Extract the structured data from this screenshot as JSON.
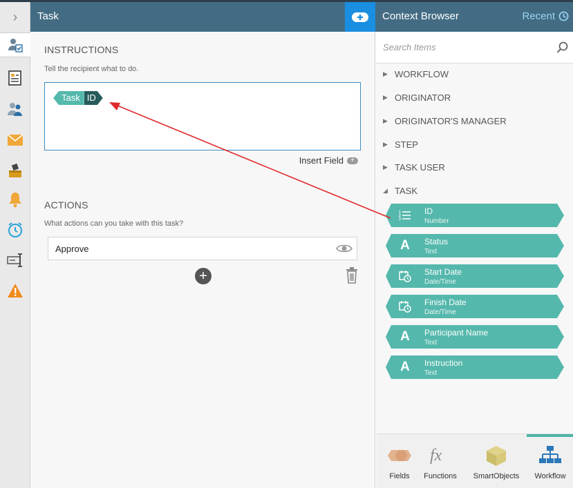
{
  "task_panel": {
    "title": "Task",
    "instructions": {
      "heading": "INSTRUCTIONS",
      "hint": "Tell the recipient what to do.",
      "token": {
        "context": "Task",
        "field": "ID"
      },
      "insert_field_label": "Insert Field"
    },
    "actions": {
      "heading": "ACTIONS",
      "hint": "What actions can you take with this task?",
      "items": [
        {
          "label": "Approve"
        }
      ]
    }
  },
  "context_browser": {
    "title": "Context Browser",
    "recent_label": "Recent",
    "search_placeholder": "Search Items",
    "tree": [
      {
        "label": "WORKFLOW",
        "expanded": false
      },
      {
        "label": "ORIGINATOR",
        "expanded": false
      },
      {
        "label": "ORIGINATOR'S MANAGER",
        "expanded": false
      },
      {
        "label": "STEP",
        "expanded": false
      },
      {
        "label": "TASK USER",
        "expanded": false
      },
      {
        "label": "TASK",
        "expanded": true
      }
    ],
    "task_fields": [
      {
        "name": "ID",
        "type": "Number",
        "icon": "number-list-icon"
      },
      {
        "name": "Status",
        "type": "Text",
        "icon": "text-a-icon"
      },
      {
        "name": "Start Date",
        "type": "Date/Time",
        "icon": "calendar-clock-icon"
      },
      {
        "name": "Finish Date",
        "type": "Date/Time",
        "icon": "calendar-clock-icon"
      },
      {
        "name": "Participant Name",
        "type": "Text",
        "icon": "text-a-icon"
      },
      {
        "name": "Instruction",
        "type": "Text",
        "icon": "text-a-icon"
      }
    ],
    "tabs": [
      {
        "label": "Fields",
        "icon": "fields-icon",
        "active": false
      },
      {
        "label": "Functions",
        "icon": "fx-icon",
        "active": false
      },
      {
        "label": "SmartObjects",
        "icon": "smartobject-cube-icon",
        "active": false
      },
      {
        "label": "Workflow",
        "icon": "workflow-tree-icon",
        "active": true
      }
    ]
  },
  "colors": {
    "header": "#436c84",
    "accent_blue": "#1a8ee0",
    "field_teal": "#55b8ac",
    "token_dark": "#265b5a",
    "arrow_red": "#e02a2a"
  }
}
